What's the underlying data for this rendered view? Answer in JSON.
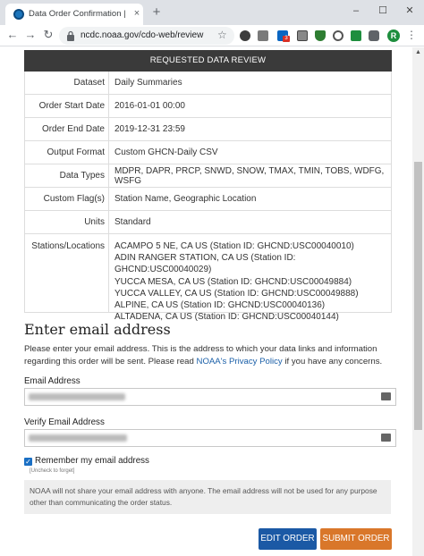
{
  "browser": {
    "tab_title": "Data Order Confirmation | Climate",
    "tab_close": "×",
    "new_tab": "+",
    "window": {
      "minimize": "–",
      "maximize": "☐",
      "close": "✕"
    },
    "nav": {
      "back": "←",
      "forward": "→",
      "reload": "↻"
    },
    "url": "ncdc.noaa.gov/cdo-web/review",
    "bookmark_star": "☆",
    "extension_badge": "3",
    "avatar_letter": "R",
    "menu": "⋮"
  },
  "review": {
    "header": "REQUESTED DATA REVIEW",
    "rows": [
      {
        "label": "Dataset",
        "value": "Daily Summaries"
      },
      {
        "label": "Order Start Date",
        "value": "2016-01-01 00:00"
      },
      {
        "label": "Order End Date",
        "value": "2019-12-31 23:59"
      },
      {
        "label": "Output Format",
        "value": "Custom GHCN-Daily CSV"
      },
      {
        "label": "Data Types",
        "value": "MDPR, DAPR, PRCP, SNWD, SNOW, TMAX, TMIN, TOBS, WDFG, WSFG"
      },
      {
        "label": "Custom Flag(s)",
        "value": "Station Name, Geographic Location"
      },
      {
        "label": "Units",
        "value": "Standard"
      }
    ],
    "stations_label": "Stations/Locations",
    "stations": [
      "ACAMPO 5 NE, CA US (Station ID: GHCND:USC00040010)",
      "ADIN RANGER STATION, CA US (Station ID: GHCND:USC00040029)",
      "YUCCA MESA, CA US (Station ID: GHCND:USC00049884)",
      "YUCCA VALLEY, CA US (Station ID: GHCND:USC00049888)",
      "ALPINE, CA US (Station ID: GHCND:USC00040136)",
      "ALTADENA, CA US (Station ID: GHCND:USC00040144)"
    ]
  },
  "email": {
    "title": "Enter email address",
    "intro_before": "Please enter your email address. This is the address to which your data links and information regarding this order will be sent. Please read ",
    "privacy_link": "NOAA's Privacy Policy",
    "intro_after": " if you have any concerns.",
    "email_label": "Email Address",
    "verify_label": "Verify Email Address",
    "remember_label": "Remember my email address",
    "uncheck_hint": "[Uncheck to forget]",
    "remember_checked": true,
    "notice": "NOAA will not share your email address with anyone. The email address will not be used for any purpose other than communicating the order status."
  },
  "actions": {
    "edit": "EDIT ORDER",
    "submit": "SUBMIT ORDER"
  },
  "colors": {
    "header_bg": "#3a3a3a",
    "edit_button": "#1b59a5",
    "submit_button": "#d9772a",
    "link": "#1a5fa8"
  }
}
